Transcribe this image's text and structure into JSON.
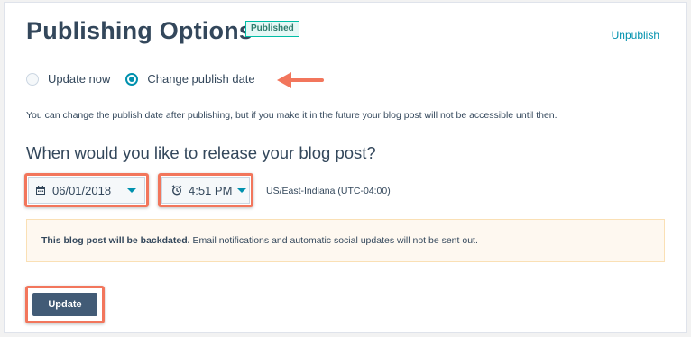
{
  "header": {
    "title": "Publishing Options",
    "status_badge": "Published",
    "unpublish_link": "Unpublish"
  },
  "publish_mode": {
    "options": [
      {
        "label": "Update now",
        "selected": false
      },
      {
        "label": "Change publish date",
        "selected": true
      }
    ]
  },
  "help_text": "You can change the publish date after publishing, but if you make it in the future your blog post will not be accessible until then.",
  "release": {
    "question": "When would you like to release your blog post?",
    "date_value": "06/01/2018",
    "time_value": "4:51 PM",
    "timezone": "US/East-Indiana (UTC-04:00)"
  },
  "alert": {
    "bold_text": "This blog post will be backdated.",
    "text": "Email notifications and automatic social updates will not be sent out."
  },
  "actions": {
    "update_label": "Update"
  },
  "colors": {
    "accent": "#0091ae",
    "highlight": "#f2765c",
    "primary_button": "#425b76",
    "badge_border": "#00bda5",
    "alert_bg": "#fef8f0"
  },
  "icons": [
    "calendar-icon",
    "clock-icon",
    "chevron-down-icon",
    "arrow-pointer-icon"
  ]
}
